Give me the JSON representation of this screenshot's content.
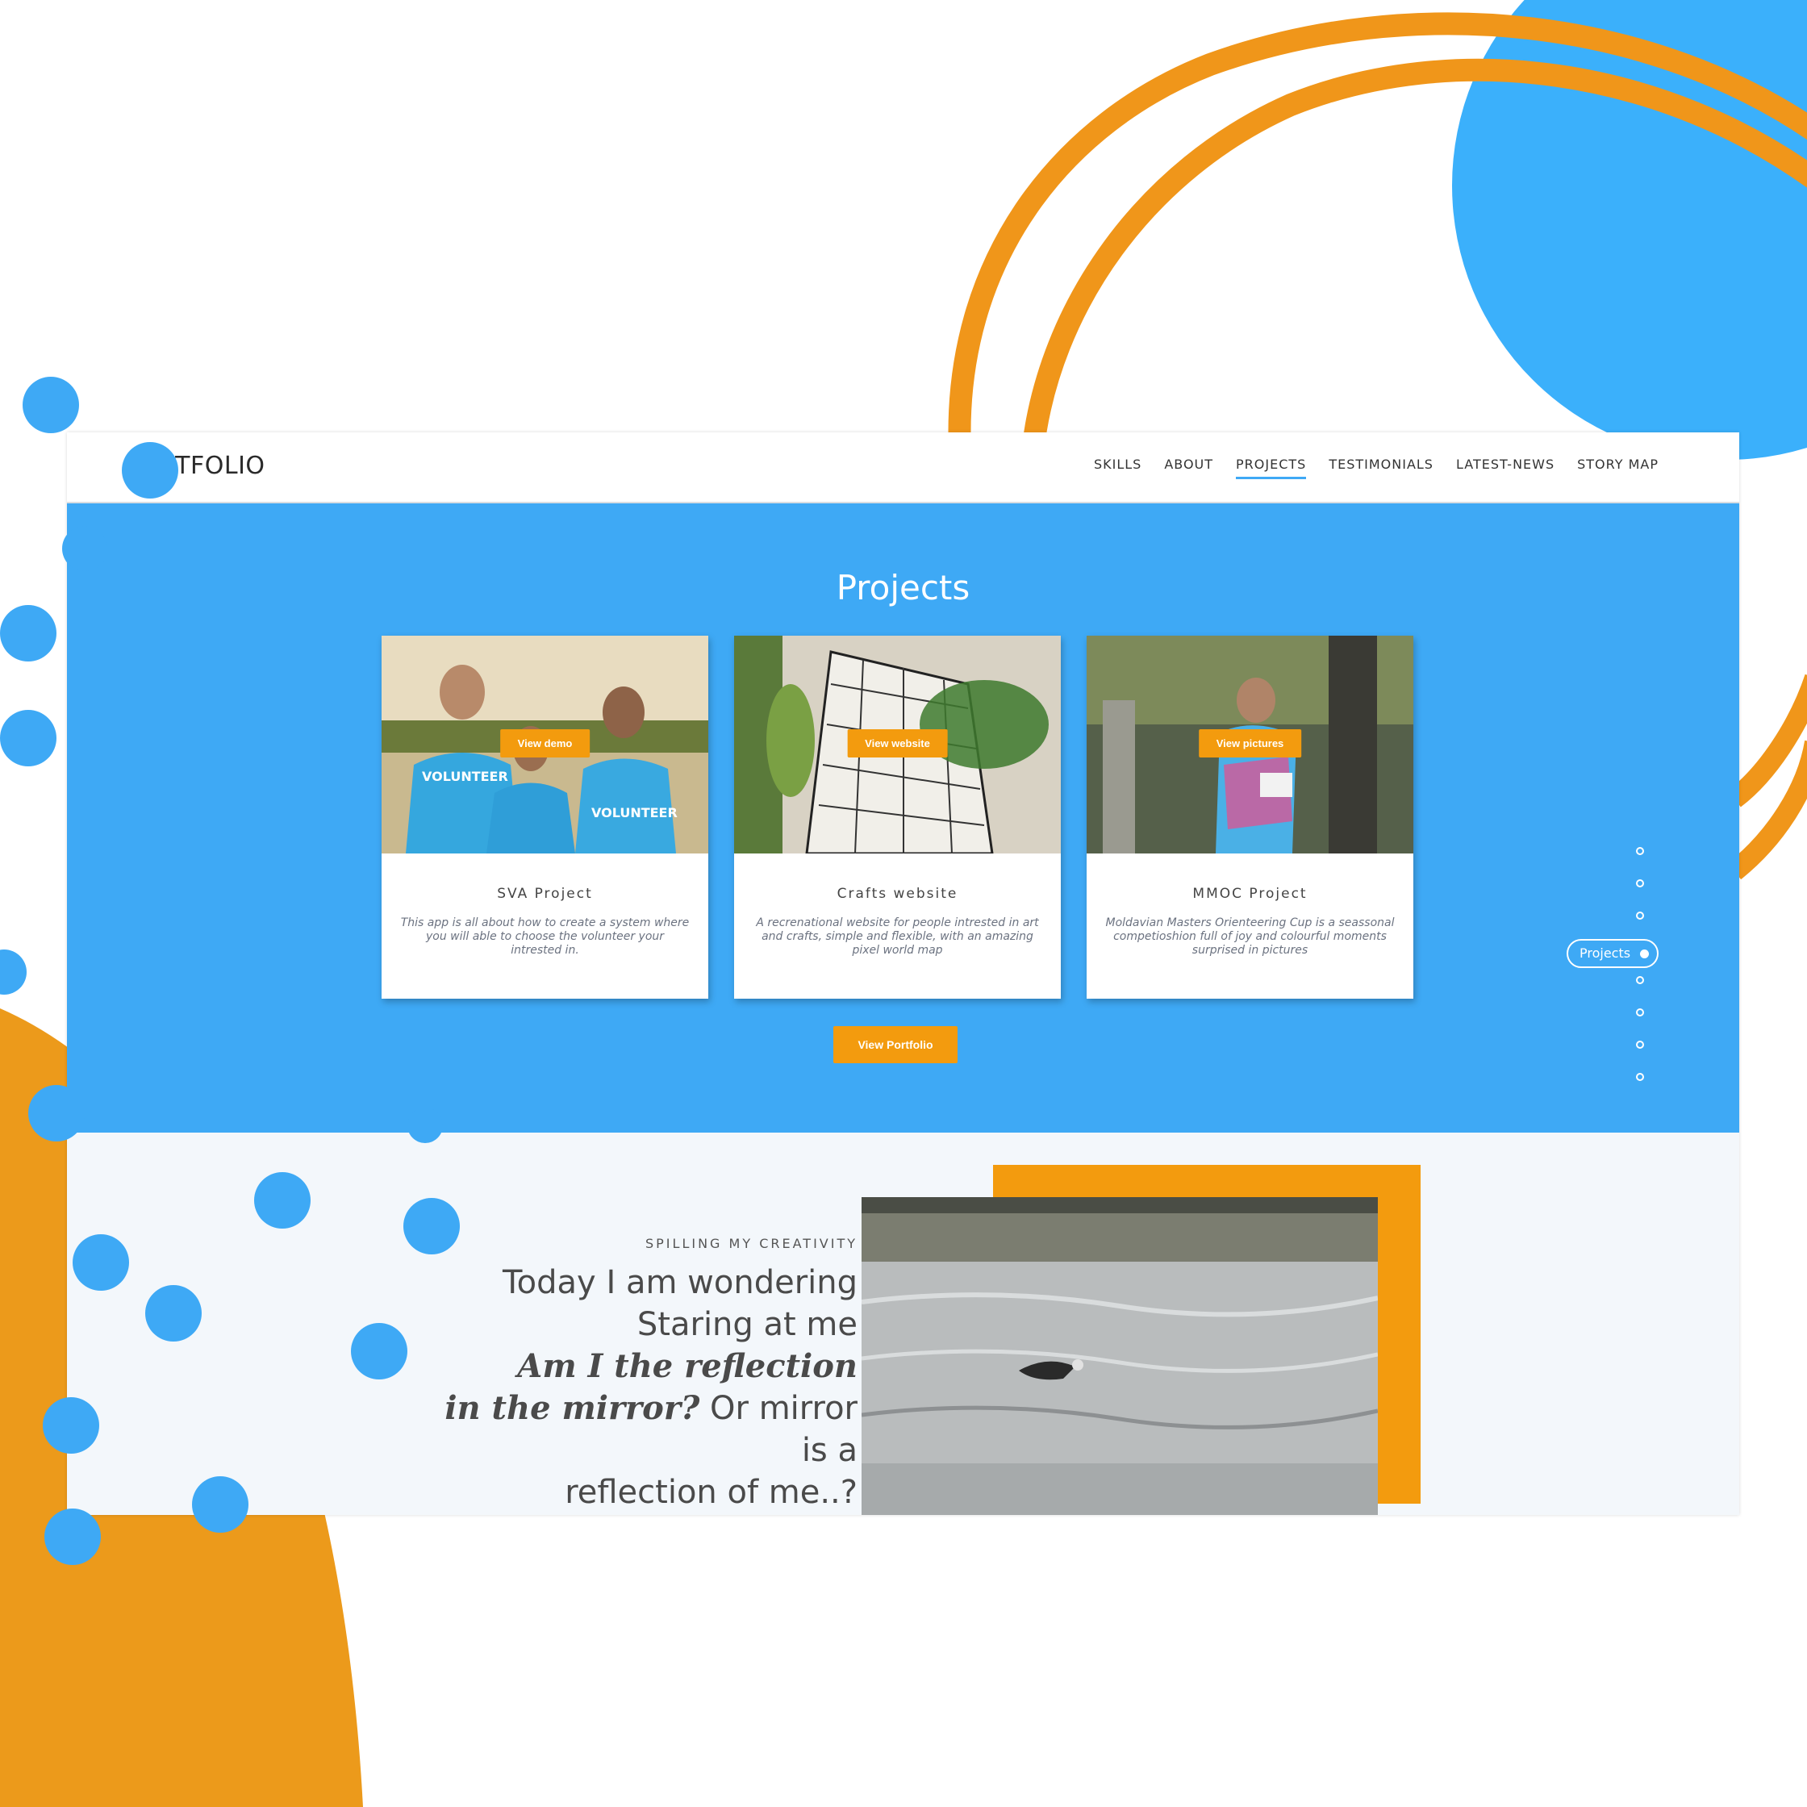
{
  "colors": {
    "accent_blue": "#3ea9f5",
    "accent_orange": "#f39b0e",
    "text_dark": "#333333"
  },
  "site": {
    "logo": "RTFOLIO",
    "nav": [
      {
        "label": "SKILLS",
        "active": false
      },
      {
        "label": "ABOUT",
        "active": false
      },
      {
        "label": "PROJECTS",
        "active": true
      },
      {
        "label": "TESTIMONIALS",
        "active": false
      },
      {
        "label": "LATEST-NEWS",
        "active": false
      },
      {
        "label": "STORY MAP",
        "active": false
      }
    ],
    "projects": {
      "title": "Projects",
      "cards": [
        {
          "button": "View demo",
          "title": "SVA Project",
          "description": "This app is all about how to create a system where you will able to choose the volunteer your intrested in.",
          "image_icon": "volunteers-photo"
        },
        {
          "button": "View website",
          "title": "Crafts website",
          "description": "A recrenational website for people intrested in art and crafts, simple and flexible,  with an amazing pixel world map",
          "image_icon": "crafts-photo"
        },
        {
          "button": "View pictures",
          "title": "MMOC Project",
          "description": "Moldavian Masters Orienteering Cup is a seassonal competioshion full of joy and colourful moments surprised in pictures",
          "image_icon": "runner-photo"
        }
      ],
      "view_portfolio": "View Portfolio"
    },
    "side_nav": {
      "active_label": "Projects"
    },
    "creativity": {
      "eyebrow": "SPILLING MY CREATIVITY",
      "line1": "Today I am wondering",
      "line2": "Staring at me",
      "line3_italic": "Am I the reflection",
      "line4_italic": "in the mirror?",
      "line4_rest": " Or mirror",
      "line5": "is a",
      "line6": "reflection of me..?"
    }
  }
}
